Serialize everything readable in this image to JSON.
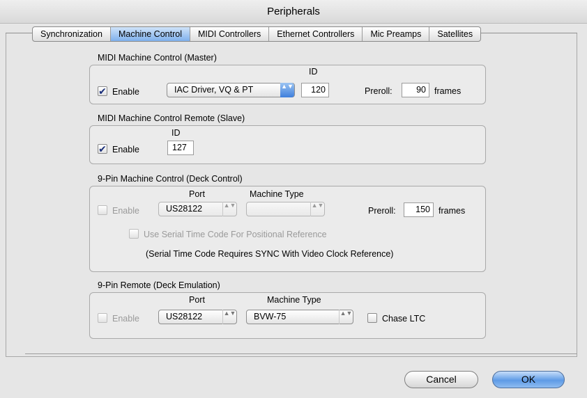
{
  "window": {
    "title": "Peripherals"
  },
  "tabs": [
    {
      "label": "Synchronization"
    },
    {
      "label": "Machine Control",
      "selected": true
    },
    {
      "label": "MIDI Controllers"
    },
    {
      "label": "Ethernet Controllers"
    },
    {
      "label": "Mic Preamps"
    },
    {
      "label": "Satellites"
    }
  ],
  "mmc_master": {
    "heading": "MIDI Machine Control (Master)",
    "enable_label": "Enable",
    "enable_checked": true,
    "device": "IAC Driver, VQ & PT",
    "id_label": "ID",
    "id_value": "120",
    "preroll_label": "Preroll:",
    "preroll_value": "90",
    "frames_label": "frames"
  },
  "mmc_remote": {
    "heading": "MIDI Machine Control Remote (Slave)",
    "enable_label": "Enable",
    "enable_checked": true,
    "id_label": "ID",
    "id_value": "127"
  },
  "ninepin_deck": {
    "heading": "9-Pin Machine Control (Deck Control)",
    "enable_label": "Enable",
    "port_label": "Port",
    "port_value": "US28122",
    "machine_type_label": "Machine Type",
    "machine_type_value": "",
    "preroll_label": "Preroll:",
    "preroll_value": "150",
    "frames_label": "frames",
    "serial_tc_label": "Use Serial Time Code For Positional Reference",
    "note": "(Serial Time Code Requires SYNC With Video Clock Reference)"
  },
  "ninepin_remote": {
    "heading": "9-Pin Remote (Deck Emulation)",
    "enable_label": "Enable",
    "port_label": "Port",
    "port_value": "US28122",
    "machine_type_label": "Machine Type",
    "machine_type_value": "BVW-75",
    "chase_ltc_label": "Chase LTC"
  },
  "buttons": {
    "cancel": "Cancel",
    "ok": "OK"
  },
  "icons": {
    "check": "✔",
    "updown": "▲▼"
  }
}
